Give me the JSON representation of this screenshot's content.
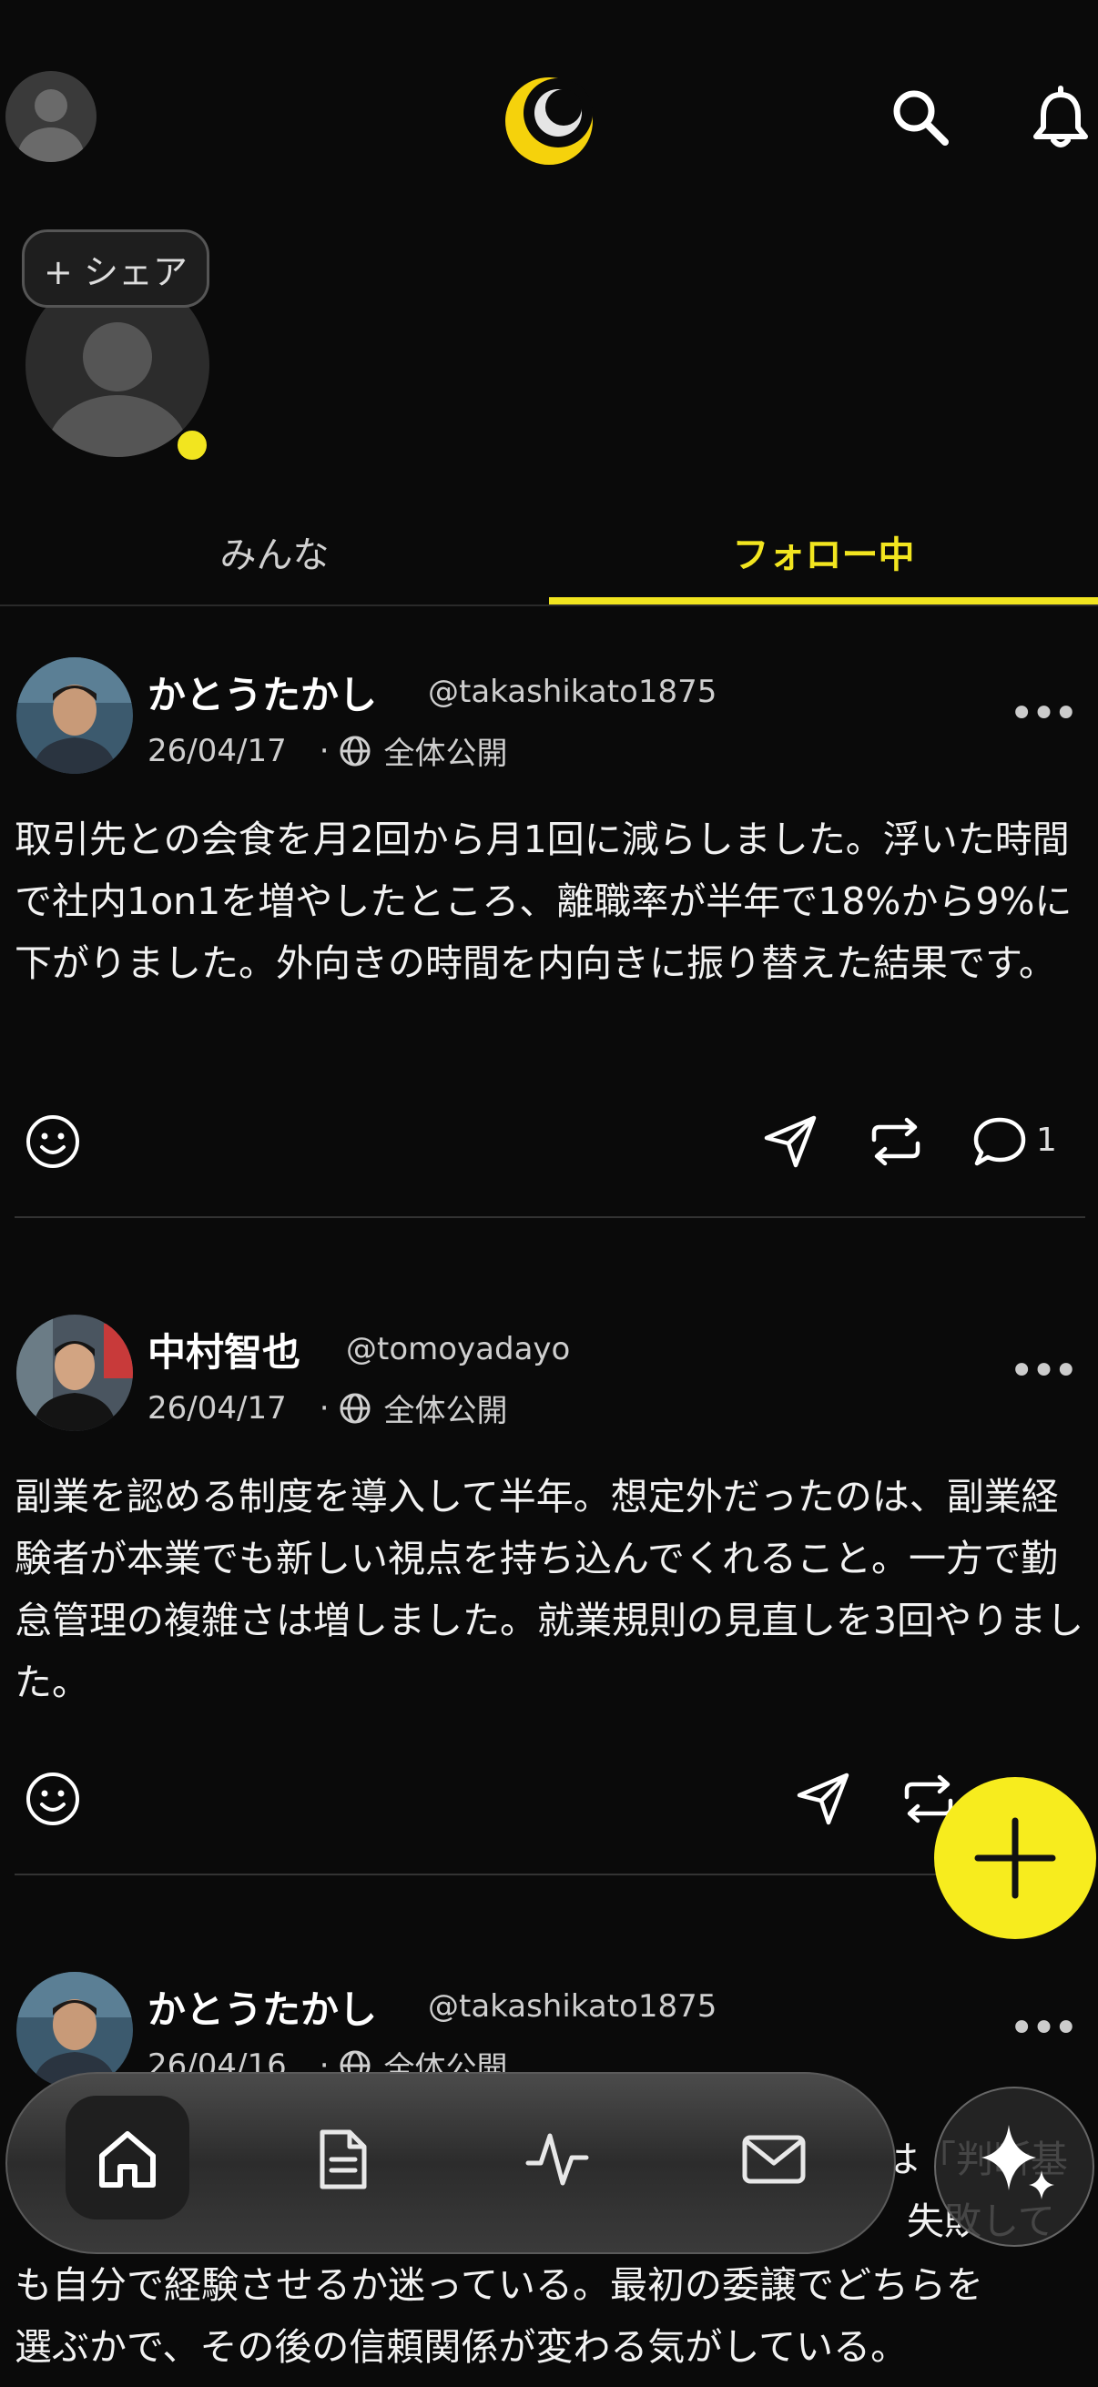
{
  "colors": {
    "accent": "#f2e51f",
    "background": "#0a0a0a"
  },
  "story": {
    "share_label": "+ シェア"
  },
  "tabs": [
    {
      "label": "みんな",
      "active": false
    },
    {
      "label": "フォロー中",
      "active": true
    }
  ],
  "posts": [
    {
      "name": "かとうたかし",
      "handle": "@takashikato1875",
      "date": "26/04/17",
      "visibility": "全体公開",
      "body": "取引先との会食を月2回から月1回に減らしました。浮いた時間で社内1on1を増やしたところ、離職率が半年で18%から9%に下がりました。外向きの時間を内向きに振り替えた結果です。",
      "comment_count": "1"
    },
    {
      "name": "中村智也",
      "handle": "@tomoyadayo",
      "date": "26/04/17",
      "visibility": "全体公開",
      "body": "副業を認める制度を導入して半年。想定外だったのは、副業経験者が本業でも新しい視点を持ち込んでくれること。一方で勤怠管理の複雑さは増しました。就業規則の見直しを3回やりました。"
    },
    {
      "name": "かとうたかし",
      "handle": "@takashikato1875",
      "date": "26/04/16",
      "visibility": "全体公開",
      "body_line_1": "は「判断基",
      "body_line_2": "失敗して",
      "body_line_3": "も自分で経験させるか迷っている。最初の委譲でどちらを",
      "body_line_4": "選ぶかで、その後の信頼関係が変わる気がしている。"
    }
  ],
  "icons": {
    "header": [
      "profile-avatar",
      "app-logo-moon",
      "search-icon",
      "bell-icon"
    ],
    "actions": [
      "smile-icon",
      "send-icon",
      "repost-icon",
      "comment-icon"
    ],
    "nav": [
      "home-icon",
      "document-icon",
      "activity-icon",
      "mail-icon",
      "sparkle-icon"
    ]
  }
}
